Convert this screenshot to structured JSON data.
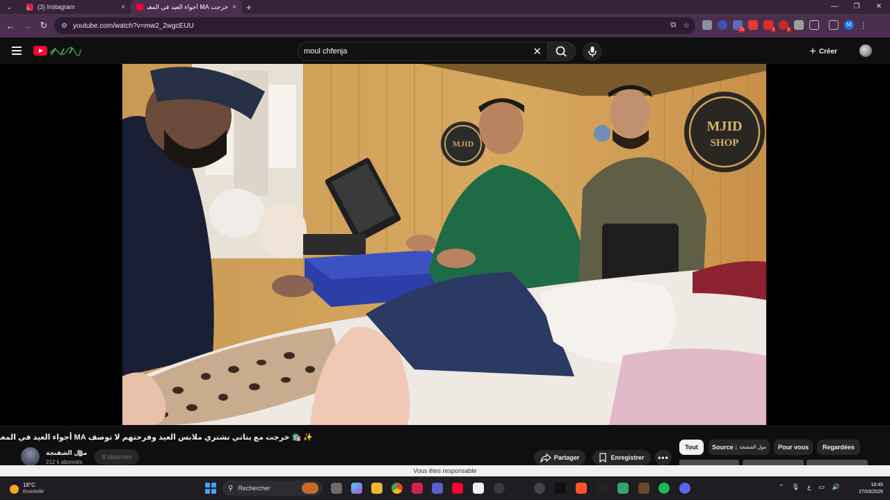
{
  "browser": {
    "tabs": [
      {
        "title": "(3) Instagram",
        "close": "×"
      },
      {
        "title": "خرجت MA أجواء العيد في المغرب",
        "close": "×"
      }
    ],
    "new_tab": "+",
    "url": "youtube.com/watch?v=mw2_2wgcEUU",
    "window_controls": {
      "minimize": "—",
      "maximize": "❐",
      "close": "✕"
    },
    "ext_badges": {
      "b1": "21",
      "b2": "1",
      "b3": "1"
    },
    "profile_initial": "M"
  },
  "youtube": {
    "search_query": "moul chfenja",
    "create_label": "Créer"
  },
  "video": {
    "title": "✨ 🛍️ خرجت مع بناتي نشتري ملابس العيد وفرحتهم لا توصف MA أجواء العيد في المغرب",
    "sign_left": "MJID",
    "sign_right_1": "MJID",
    "sign_right_2": "SHOP"
  },
  "channel": {
    "name": "مول الشفنجة",
    "subscribers": "212 k abonnés",
    "subscribe_label": "S'abonner"
  },
  "actions": {
    "share_label": "Partager",
    "save_label": "Enregistrer",
    "more_label": "•••"
  },
  "chips": [
    {
      "label": "Tout"
    },
    {
      "label": "Source : ",
      "extra": "مول الشفنجة"
    },
    {
      "label": "Pour vous"
    },
    {
      "label": "Regardées"
    }
  ],
  "toast": "Vous êtes responsable",
  "taskbar": {
    "temperature": "18°C",
    "weather": "Ensoleillé",
    "search_label": "Rechercher",
    "lang": "ع",
    "time": "18:45",
    "date": "27/03/2026"
  }
}
